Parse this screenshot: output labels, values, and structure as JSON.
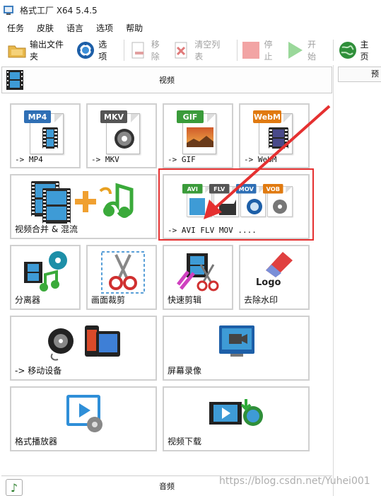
{
  "window": {
    "title": "格式工厂 X64 5.4.5"
  },
  "menu": [
    "任务",
    "皮肤",
    "语言",
    "选项",
    "帮助"
  ],
  "toolbar": {
    "output_folder": "输出文件夹",
    "options": "选项",
    "remove": "移除",
    "clear_list": "清空列表",
    "stop": "停止",
    "start": "开始",
    "home": "主页"
  },
  "panel": {
    "title": "视频"
  },
  "right_panel": {
    "header": "预"
  },
  "tiles": {
    "mp4": {
      "tag": "MP4",
      "label": "-> MP4"
    },
    "mkv": {
      "tag": "MKV",
      "label": "-> MKV"
    },
    "gif": {
      "tag": "GIF",
      "label": "-> GIF"
    },
    "webm": {
      "tag": "WebM",
      "label": "-> WebM"
    },
    "merge": {
      "label": "视频合并 & 混流"
    },
    "multi": {
      "tags": [
        "AVI",
        "FLV",
        "MOV",
        "VOB"
      ],
      "label": "-> AVI FLV MOV ...."
    },
    "splitter": {
      "label": "分离器"
    },
    "crop": {
      "label": "画面裁剪"
    },
    "quick_clip": {
      "label": "快速剪辑"
    },
    "watermark": {
      "logo": "Logo",
      "label": "去除水印"
    },
    "mobile": {
      "label": "-> 移动设备"
    },
    "screen_record": {
      "label": "屏幕录像"
    },
    "player": {
      "label": "格式播放器"
    },
    "download": {
      "label": "视频下载"
    }
  },
  "bottom": {
    "title": "音频"
  },
  "watermark_text": "https://blog.csdn.net/Yuhei001",
  "colors": {
    "mp4": "#2f6fb5",
    "mkv": "#555555",
    "gif": "#3a9b3a",
    "webm": "#e07a10",
    "annotation": "#e53030"
  }
}
